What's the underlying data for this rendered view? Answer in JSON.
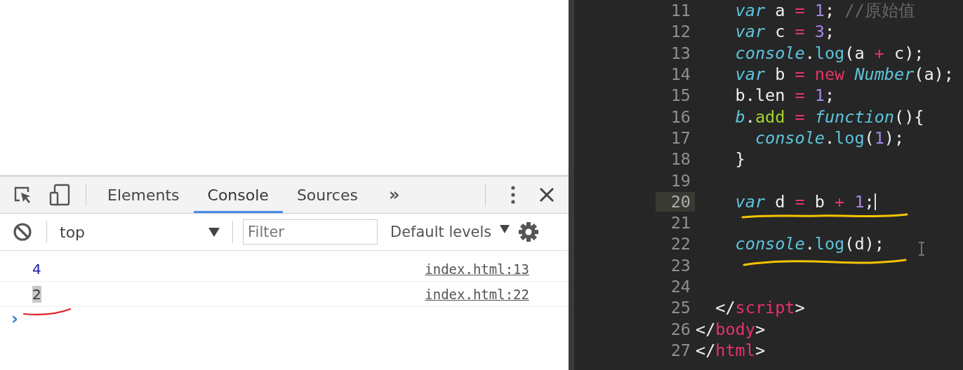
{
  "devtools": {
    "tabs": [
      {
        "label": "Elements",
        "selected": false
      },
      {
        "label": "Console",
        "selected": true
      },
      {
        "label": "Sources",
        "selected": false
      }
    ],
    "more_tabs": "»",
    "context": "top",
    "filter": {
      "placeholder": "Filter"
    },
    "levels": "Default levels",
    "messages": [
      {
        "text": "4",
        "source": "index.html:13",
        "highlighted": false
      },
      {
        "text": "2",
        "source": "index.html:22",
        "highlighted": true
      }
    ],
    "prompt": "›"
  },
  "editor": {
    "lines": [
      {
        "number": "11",
        "current": false,
        "tokens": [
          {
            "text": "    var",
            "kind": "kw"
          },
          {
            "text": " a ",
            "kind": "pl"
          },
          {
            "text": "=",
            "kind": "op"
          },
          {
            "text": " 1",
            "kind": "num"
          },
          {
            "text": "; ",
            "kind": "pl"
          },
          {
            "text": "//原始值",
            "kind": "cm"
          }
        ]
      },
      {
        "number": "12",
        "current": false,
        "tokens": [
          {
            "text": "    var",
            "kind": "kw"
          },
          {
            "text": " c ",
            "kind": "pl"
          },
          {
            "text": "=",
            "kind": "op"
          },
          {
            "text": " 3",
            "kind": "num"
          },
          {
            "text": ";",
            "kind": "pl"
          }
        ]
      },
      {
        "number": "13",
        "current": false,
        "tokens": [
          {
            "text": "    console",
            "kind": "fn"
          },
          {
            "text": ".",
            "kind": "pl"
          },
          {
            "text": "log",
            "kind": "method"
          },
          {
            "text": "(a ",
            "kind": "pl"
          },
          {
            "text": "+",
            "kind": "op"
          },
          {
            "text": " c);",
            "kind": "pl"
          }
        ]
      },
      {
        "number": "14",
        "current": false,
        "tokens": [
          {
            "text": "    var",
            "kind": "kw"
          },
          {
            "text": " b ",
            "kind": "pl"
          },
          {
            "text": "=",
            "kind": "op"
          },
          {
            "text": " new",
            "kind": "new"
          },
          {
            "text": " Number",
            "kind": "fn"
          },
          {
            "text": "(a);",
            "kind": "pl"
          }
        ]
      },
      {
        "number": "15",
        "current": false,
        "tokens": [
          {
            "text": "    b.len ",
            "kind": "pl"
          },
          {
            "text": "=",
            "kind": "op"
          },
          {
            "text": " 1",
            "kind": "num"
          },
          {
            "text": ";",
            "kind": "pl"
          }
        ]
      },
      {
        "number": "16",
        "current": false,
        "tokens": [
          {
            "text": "    b",
            "kind": "fn"
          },
          {
            "text": ".",
            "kind": "pl"
          },
          {
            "text": "add",
            "kind": "prop"
          },
          {
            "text": " =",
            "kind": "op"
          },
          {
            "text": " function",
            "kind": "kw"
          },
          {
            "text": "(){",
            "kind": "pl"
          }
        ]
      },
      {
        "number": "17",
        "current": false,
        "tokens": [
          {
            "text": "      console",
            "kind": "fn"
          },
          {
            "text": ".",
            "kind": "pl"
          },
          {
            "text": "log",
            "kind": "method"
          },
          {
            "text": "(",
            "kind": "pl"
          },
          {
            "text": "1",
            "kind": "num"
          },
          {
            "text": ");",
            "kind": "pl"
          }
        ]
      },
      {
        "number": "18",
        "current": false,
        "tokens": [
          {
            "text": "    }",
            "kind": "pl"
          }
        ]
      },
      {
        "number": "19",
        "current": false
      },
      {
        "number": "20",
        "current": true,
        "tokens": [
          {
            "text": "    var",
            "kind": "kw"
          },
          {
            "text": " d ",
            "kind": "pl"
          },
          {
            "text": "=",
            "kind": "op"
          },
          {
            "text": " b ",
            "kind": "pl"
          },
          {
            "text": "+",
            "kind": "op"
          },
          {
            "text": " 1",
            "kind": "num"
          },
          {
            "text": ";",
            "kind": "pl"
          }
        ]
      },
      {
        "number": "21",
        "current": false
      },
      {
        "number": "22",
        "current": false,
        "tokens": [
          {
            "text": "    console",
            "kind": "fn"
          },
          {
            "text": ".",
            "kind": "pl"
          },
          {
            "text": "log",
            "kind": "method"
          },
          {
            "text": "(d);",
            "kind": "pl"
          }
        ]
      },
      {
        "number": "23",
        "current": false
      },
      {
        "number": "24",
        "current": false
      },
      {
        "number": "25",
        "current": false,
        "tokens": [
          {
            "text": "  </",
            "kind": "pl"
          },
          {
            "text": "script",
            "kind": "tag"
          },
          {
            "text": ">",
            "kind": "pl"
          }
        ]
      },
      {
        "number": "26",
        "current": false,
        "tokens": [
          {
            "text": "</",
            "kind": "pl"
          },
          {
            "text": "body",
            "kind": "tag"
          },
          {
            "text": ">",
            "kind": "pl"
          }
        ]
      },
      {
        "number": "27",
        "current": false,
        "tokens": [
          {
            "text": "</",
            "kind": "pl"
          },
          {
            "text": "html",
            "kind": "tag"
          },
          {
            "text": ">",
            "kind": "pl"
          }
        ]
      }
    ]
  }
}
